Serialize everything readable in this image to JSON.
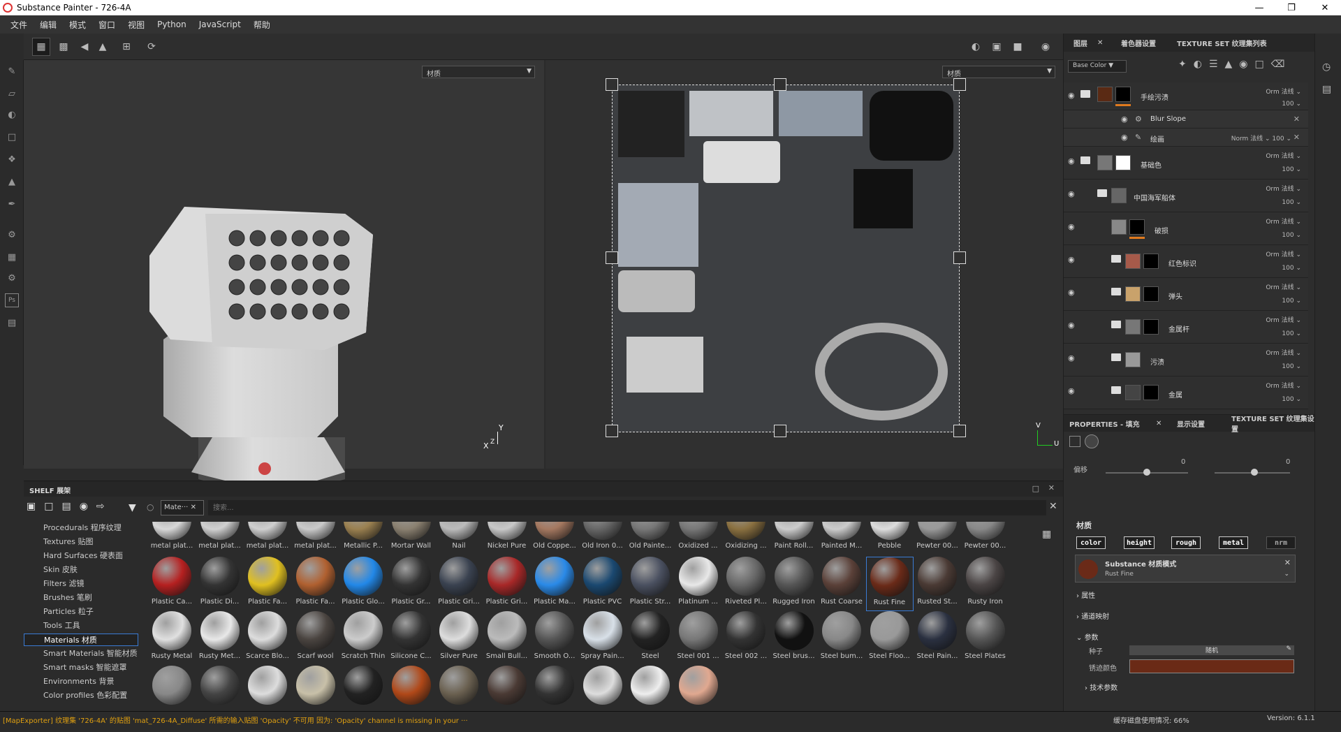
{
  "app": {
    "title": "Substance Painter - 726-4A"
  },
  "menu": [
    "文件",
    "编辑",
    "模式",
    "窗口",
    "视图",
    "Python",
    "JavaScript",
    "帮助"
  ],
  "viewport": {
    "left_dropdown": "材质",
    "right_dropdown": "材质",
    "axis_y": "Y",
    "axis_x": "X",
    "axis_z": "Z",
    "uv_v": "V",
    "uv_u": "U"
  },
  "layers_panel": {
    "tabs": [
      "图层",
      "着色器设置",
      "TEXTURE SET 纹理集列表"
    ],
    "channel_select": "Base Color",
    "layers": [
      {
        "name": "手绘污渍",
        "blend": "Orm 法线 ⌄",
        "opacity": "100 ⌄",
        "thumb": "#5a2a14",
        "mask": "#000"
      },
      {
        "name": "Blur Slope",
        "blend": "",
        "opacity": "",
        "thumb": "",
        "mask": ""
      },
      {
        "name": "绘画",
        "blend": "Norm 法线 ⌄",
        "opacity": "100 ⌄",
        "thumb": "",
        "mask": ""
      },
      {
        "name": "基础色",
        "blend": "Orm 法线 ⌄",
        "opacity": "100 ⌄",
        "thumb": "#777",
        "mask": "#fff"
      },
      {
        "name": "中国海军船体",
        "blend": "Orm 法线 ⌄",
        "opacity": "100 ⌄",
        "thumb": "#666",
        "mask": ""
      },
      {
        "name": "破损",
        "blend": "Orm 法线 ⌄",
        "opacity": "100 ⌄",
        "thumb": "#888",
        "mask": "#000"
      },
      {
        "name": "红色标识",
        "blend": "Orm 法线 ⌄",
        "opacity": "100 ⌄",
        "thumb": "#a65a4a",
        "mask": "#000"
      },
      {
        "name": "弹头",
        "blend": "Orm 法线 ⌄",
        "opacity": "100 ⌄",
        "thumb": "#c9a26b",
        "mask": "#000"
      },
      {
        "name": "金属杆",
        "blend": "Orm 法线 ⌄",
        "opacity": "100 ⌄",
        "thumb": "#777",
        "mask": "#000"
      },
      {
        "name": "污渍",
        "blend": "Orm 法线 ⌄",
        "opacity": "100 ⌄",
        "thumb": "#999",
        "mask": ""
      },
      {
        "name": "金属",
        "blend": "Orm 法线 ⌄",
        "opacity": "100 ⌄",
        "thumb": "#444",
        "mask": "#000"
      }
    ]
  },
  "properties_panel": {
    "tabs": [
      "PROPERTIES - 填充",
      "显示设置",
      "TEXTURE SET 纹理集设置"
    ],
    "offset_label": "偏移",
    "offset_left": "0",
    "offset_right": "0",
    "material_header": "材质",
    "channels": [
      "color",
      "height",
      "rough",
      "metal",
      "nrm"
    ],
    "substance_title": "Substance 材质模式",
    "substance_value": "Rust Fine",
    "sections": [
      "属性",
      "通道映射",
      "参数"
    ],
    "seed_label": "种子",
    "seed_value": "随机",
    "rust_color_label": "锈迹颜色",
    "rust_color": "#6a2a16",
    "tech_params": "技术参数"
  },
  "shelf": {
    "title": "SHELF 展架",
    "filter_tag": "Mate···",
    "search_placeholder": "搜索...",
    "categories": [
      "Procedurals 程序纹理",
      "Textures 贴图",
      "Hard Surfaces 硬表面",
      "Skin 皮肤",
      "Filters 滤镜",
      "Brushes 笔刷",
      "Particles 粒子",
      "Tools 工具",
      "Materials 材质",
      "Smart Materials 智能材质",
      "Smart masks 智能遮罩",
      "Environments 背景",
      "Color profiles 色彩配置"
    ],
    "selected_category": "Materials 材质",
    "rows": [
      [
        {
          "l": "metal plat...",
          "c": "#d8d8d8"
        },
        {
          "l": "metal plat...",
          "c": "#d0d0d0"
        },
        {
          "l": "metal plat...",
          "c": "#cfcfcf"
        },
        {
          "l": "metal plat...",
          "c": "#cacaca"
        },
        {
          "l": "Metallic P...",
          "c": "#9a8050"
        },
        {
          "l": "Mortar Wall",
          "c": "#8a8070"
        },
        {
          "l": "Nail",
          "c": "#bbb"
        },
        {
          "l": "Nickel Pure",
          "c": "#c8c8c8"
        },
        {
          "l": "Old Coppe...",
          "c": "#a47860"
        },
        {
          "l": "Old Iron 0...",
          "c": "#666"
        },
        {
          "l": "Old Painte...",
          "c": "#777"
        },
        {
          "l": "Oxidized ...",
          "c": "#777"
        },
        {
          "l": "Oxidizing ...",
          "c": "#8a7040"
        },
        {
          "l": "Paint Roll...",
          "c": "#ccc"
        },
        {
          "l": "Painted M...",
          "c": "#ccc"
        },
        {
          "l": "Pebble",
          "c": "#ddd"
        },
        {
          "l": "Pewter 00...",
          "c": "#999"
        },
        {
          "l": "Pewter 00...",
          "c": "#888"
        }
      ],
      [
        {
          "l": "Plastic Ca...",
          "c": "#b52020"
        },
        {
          "l": "Plastic Di...",
          "c": "#333"
        },
        {
          "l": "Plastic Fa...",
          "c": "#e0c020"
        },
        {
          "l": "Plastic Fa...",
          "c": "#b06030"
        },
        {
          "l": "Plastic Glo...",
          "c": "#2288e8"
        },
        {
          "l": "Plastic Gr...",
          "c": "#333"
        },
        {
          "l": "Plastic Gri...",
          "c": "#3a4250"
        },
        {
          "l": "Plastic Gri...",
          "c": "#a82828"
        },
        {
          "l": "Plastic Ma...",
          "c": "#2a8ae8"
        },
        {
          "l": "Plastic PVC",
          "c": "#1a4870"
        },
        {
          "l": "Plastic Str...",
          "c": "#4a5060"
        },
        {
          "l": "Platinum ...",
          "c": "#e8e8e8"
        },
        {
          "l": "Riveted Pl...",
          "c": "#666"
        },
        {
          "l": "Rugged Iron",
          "c": "#555"
        },
        {
          "l": "Rust Coarse",
          "c": "#5a4038"
        },
        {
          "l": "Rust Fine",
          "c": "#6a2a18"
        },
        {
          "l": "Rusted St...",
          "c": "#4a3a34"
        },
        {
          "l": "Rusty Iron",
          "c": "#4a4444"
        }
      ],
      [
        {
          "l": "Rusty Metal",
          "c": "#e0e0e0"
        },
        {
          "l": "Rusty Met...",
          "c": "#e8e8e8"
        },
        {
          "l": "Scarce Blo...",
          "c": "#ddd"
        },
        {
          "l": "Scarf wool",
          "c": "#4a4440"
        },
        {
          "l": "Scratch Thin",
          "c": "#ccc"
        },
        {
          "l": "Silicone C...",
          "c": "#333"
        },
        {
          "l": "Silver Pure",
          "c": "#ddd"
        },
        {
          "l": "Small Bull...",
          "c": "#bbb"
        },
        {
          "l": "Smooth O...",
          "c": "#555"
        },
        {
          "l": "Spray Pain...",
          "c": "#d8e0e8"
        },
        {
          "l": "Steel",
          "c": "#222"
        },
        {
          "l": "Steel 001 ...",
          "c": "#777"
        },
        {
          "l": "Steel 002 ...",
          "c": "#333"
        },
        {
          "l": "Steel brus...",
          "c": "#111"
        },
        {
          "l": "Steel bum...",
          "c": "#888"
        },
        {
          "l": "Steel Floo...",
          "c": "#999"
        },
        {
          "l": "Steel Pain...",
          "c": "#2a3040"
        },
        {
          "l": "Steel Plates",
          "c": "#555"
        }
      ],
      [
        {
          "l": "",
          "c": "#888"
        },
        {
          "l": "",
          "c": "#444"
        },
        {
          "l": "",
          "c": "#ddd"
        },
        {
          "l": "",
          "c": "#c8c0a8"
        },
        {
          "l": "",
          "c": "#222"
        },
        {
          "l": "",
          "c": "#b04818"
        },
        {
          "l": "",
          "c": "#6a6050"
        },
        {
          "l": "",
          "c": "#4a3a34"
        },
        {
          "l": "",
          "c": "#333"
        },
        {
          "l": "",
          "c": "#ddd"
        },
        {
          "l": "",
          "c": "#eee"
        },
        {
          "l": "",
          "c": "#e0a890"
        }
      ]
    ]
  },
  "status": {
    "message": "[MapExporter] 纹理集 '726-4A' 的贴图 'mat_726-4A_Diffuse' 所需的输入贴图 'Opacity' 不可用 因为: 'Opacity' channel is missing in your ···",
    "cache": "缓存磁盘使用情况: 66%",
    "version": "Version: 6.1.1"
  }
}
